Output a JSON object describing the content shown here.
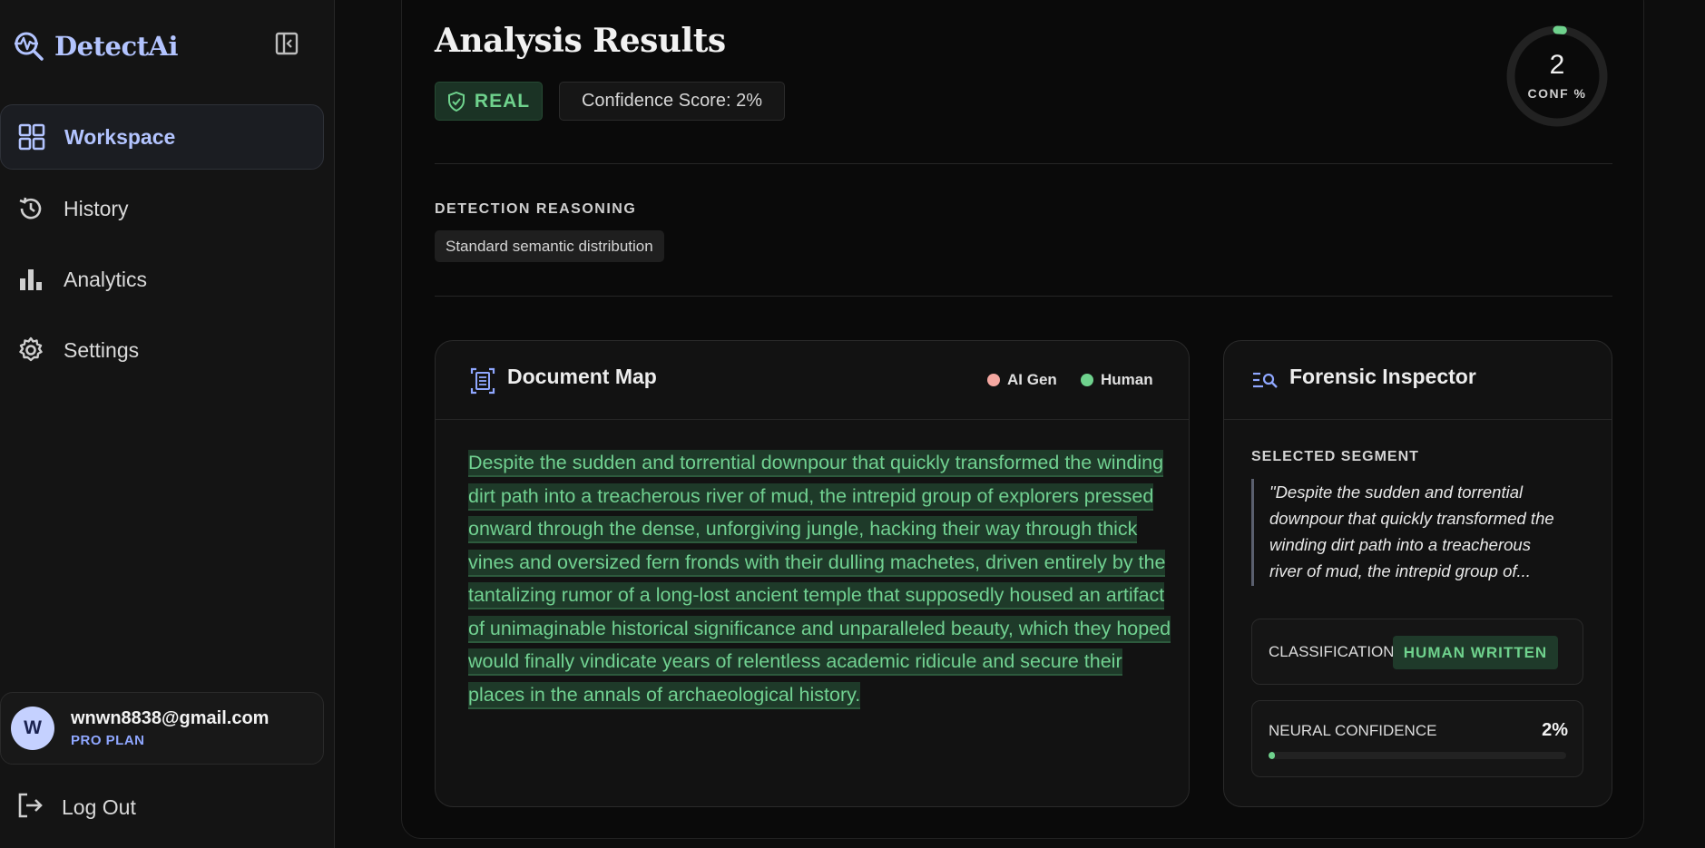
{
  "app": {
    "name": "DetectAi"
  },
  "sidebar": {
    "items": [
      {
        "label": "Workspace",
        "icon": "grid-icon",
        "active": true
      },
      {
        "label": "History",
        "icon": "history-icon"
      },
      {
        "label": "Analytics",
        "icon": "bar-chart-icon"
      },
      {
        "label": "Settings",
        "icon": "gear-icon"
      }
    ],
    "user": {
      "initial": "W",
      "email": "wnwn8838@gmail.com",
      "plan": "PRO PLAN"
    },
    "logout_label": "Log Out"
  },
  "results": {
    "title": "Analysis Results",
    "verdict": "REAL",
    "confidence_text": "Confidence Score: 2%",
    "gauge": {
      "value": "2",
      "label": "CONF %",
      "percent": 2
    },
    "reasoning_heading": "DETECTION REASONING",
    "reasoning_tag": "Standard semantic distribution"
  },
  "document_map": {
    "title": "Document Map",
    "legend": [
      {
        "label": "AI Gen",
        "color": "#f4a7a0"
      },
      {
        "label": "Human",
        "color": "#6fd28d"
      }
    ],
    "text": " Despite the sudden and torrential downpour that quickly transformed the winding dirt path into a treacherous river of mud, the intrepid group of explorers pressed onward through the dense, unforgiving jungle, hacking their way through thick vines and oversized fern fronds with their dulling machetes, driven entirely by the tantalizing rumor of a long-lost ancient temple that supposedly housed an artifact of unimaginable historical significance and unparalleled beauty, which they hoped would finally vindicate years of relentless academic ridicule and secure their places in the annals of archaeological history. "
  },
  "inspector": {
    "title": "Forensic Inspector",
    "segment_heading": "SELECTED SEGMENT",
    "segment_quote": "\"Despite the sudden and torrential downpour that quickly transformed the winding dirt path into a treacherous river of mud, the intrepid group of...",
    "classification_label": "CLASSIFICATION",
    "classification_value": "HUMAN WRITTEN",
    "neural_label": "NEURAL CONFIDENCE",
    "neural_value": "2%",
    "neural_percent": 2
  },
  "colors": {
    "accent": "#b3c4ff",
    "human": "#6fd28d",
    "ai": "#f4a7a0"
  }
}
